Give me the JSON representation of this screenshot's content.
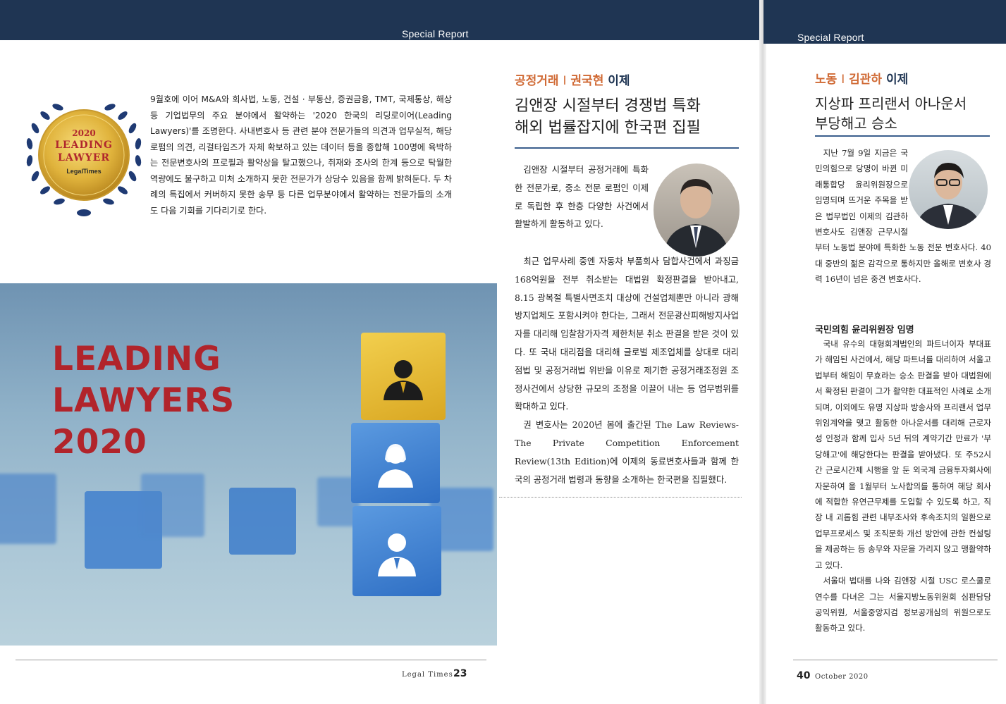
{
  "left_page": {
    "section_label": "Special Report",
    "badge": {
      "year": "2020",
      "line1": "LEADING",
      "line2": "LAWYER",
      "brand": "LegalTimes"
    },
    "intro_text": "9월호에 이어 M&A와 회사법, 노동, 건설 · 부동산, 증권금융, TMT, 국제통상, 해상 등 기업법무의 주요 분야에서 활약하는 '2020 한국의 리딩로이어(Leading Lawyers)'를 조명한다. 사내변호사 등 관련 분야 전문가들의 의견과 업무실적, 해당 로펌의 의견, 리걸타임즈가 자체 확보하고 있는 데이터 등을 종합해 100명에 육박하는 전문변호사의 프로필과 활약상을 탈고했으나, 취재와 조사의 한계 등으로 탁월한 역량에도 불구하고 미처 소개하지 못한 전문가가 상당수 있음을 함께 밝혀둔다. 두 차례의 특집에서 커버하지 못한 송무 등 다른 업무분야에서 활약하는 전문가들의 소개도 다음 기회를 기다리기로 한다.",
    "headline": [
      "LEADING",
      "LAWYERS",
      "2020"
    ],
    "footer_brand": "Legal Times",
    "page_number": "23"
  },
  "right_page": {
    "section_label": "Special Report",
    "article1": {
      "kicker_field": "공정거래",
      "kicker_sep": "I",
      "kicker_name": "권국현",
      "kicker_role": "이제",
      "title_lines": [
        "김앤장 시절부터 경쟁법 특화",
        "해외 법률잡지에 한국편 집필"
      ],
      "paragraphs": [
        "김앤장 시절부터 공정거래에 특화한 전문가로, 중소 전문 로펌인 이제로 독립한 후 한층 다양한 사건에서 활발하게 활동하고 있다.",
        "최근 업무사례 중엔 자동차 부품회사 담합사건에서 과징금 168억원을 전부 취소받는 대법원 확정판결을 받아내고, 8.15 광복절 특별사면조치 대상에 건설업체뿐만 아니라 광해방지업체도 포함시켜야 한다는, 그래서 전문광산피해방지사업자를 대리해 입찰참가자격 제한처분 취소 판결을 받은 것이 있다. 또 국내 대리점을 대리해 글로벌 제조업체를 상대로 대리점법 및 공정거래법 위반을 이유로 제기한 공정거래조정원 조정사건에서 상당한 규모의 조정을 이끌어 내는 등 업무범위를 확대하고 있다.",
        "권 변호사는 2020년 봄에 출간된 The Law Reviews-The Private Competition Enforcement Review(13th Edition)에 이제의 동료변호사들과 함께 한국의 공정거래 법령과 동향을 소개하는 한국편을 집필했다."
      ]
    },
    "article2": {
      "kicker_field": "노동",
      "kicker_sep": "I",
      "kicker_name": "김관하",
      "kicker_role": "이제",
      "title_lines": [
        "지상파 프리랜서 아나운서",
        "부당해고 승소"
      ],
      "paragraphs": [
        "지난 7월 9일 지금은 국민의힘으로 당명이 바뀐 미래통합당 윤리위원장으로 임명되며 뜨거운 주목을 받은 법무법인 이제의 김관하 변호사도 김앤장 근무시절부터 노동법 분야에 특화한 노동 전문 변호사다. 40대 중반의 젊은 감각으로 통하지만 올해로 변호사 경력 16년이 넘은 중견 변호사다."
      ],
      "subhead": "국민의힘 윤리위원장 임명",
      "paragraphs2": [
        "국내 유수의 대형회계법인의 파트너이자 부대표가 해임된 사건에서, 해당 파트너를 대리하여 서울고법부터 해임이 무효라는 승소 판결을 받아 대법원에서 확정된 판결이 그가 활약한 대표적인 사례로 소개되며, 이외에도 유명 지상파 방송사와 프리랜서 업무 위임계약을 맺고 활동한 아나운서를 대리해 근로자성 인정과 함께 입사 5년 뒤의 계약기간 만료가 '부당해고'에 해당한다는 판결을 받아냈다. 또 주52시간 근로시간제 시행을 앞 둔 외국계 금융투자회사에 자문하여 올 1월부터 노사합의를 통하여 해당 회사에 적합한 유연근무제를 도입할 수 있도록 하고, 직장 내 괴롭힘 관련 내부조사와 후속조치의 일환으로 업무프로세스 및 조직문화 개선 방안에 관한 컨설팅을 제공하는 등 송무와 자문을 가리지 않고 맹활약하고 있다.",
        "서울대 법대를 나와 김앤장 시절 USC 로스쿨로 연수를 다녀온 그는 서울지방노동위원회 심판담당 공익위원, 서울중앙지검 정보공개심의 위원으로도 활동하고 있다."
      ]
    },
    "page_number": "40",
    "footer_date": "October 2020"
  }
}
